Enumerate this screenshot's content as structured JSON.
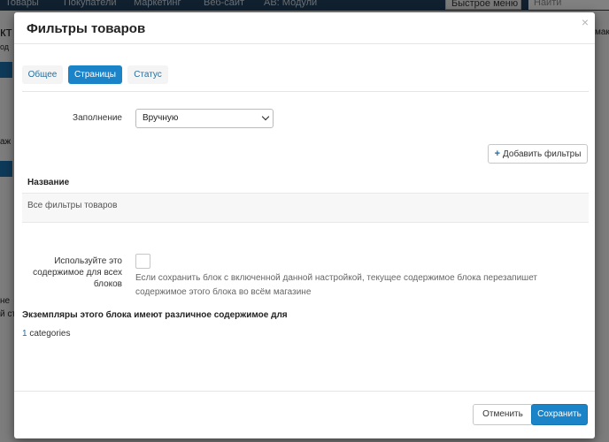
{
  "background": {
    "nav": [
      "Товары",
      "Покупатели",
      "Маркетинг",
      "Веб-сайт",
      "AB: Модули"
    ],
    "quick_menu": "Быстрое меню",
    "search_placeholder": "Найти",
    "left_fragments": [
      "кт",
      "од",
      "аж",
      "не",
      "й ст"
    ],
    "right_fragment": "мак"
  },
  "modal": {
    "title": "Фильтры товаров",
    "close_glyph": "×",
    "tabs": [
      {
        "label": "Общее",
        "active": false
      },
      {
        "label": "Страницы",
        "active": true
      },
      {
        "label": "Статус",
        "active": false
      }
    ],
    "fill": {
      "label": "Заполнение",
      "selected": "Вручную"
    },
    "add_filters_label": "Добавить фильтры",
    "table": {
      "header": "Название",
      "rows": [
        "Все фильтры товаров"
      ]
    },
    "use_for_all": {
      "label_lines": [
        "Используйте это",
        "содержимое для всех",
        "блоков"
      ],
      "checked": false,
      "help": "Если сохранить блок с включенной данной настройкой, текущее содержимое блока перезапишет содержимое этого блока во всём магазине"
    },
    "instances": {
      "title": "Экземпляры этого блока имеют различное содержимое для",
      "count": "1",
      "entity": "categories"
    },
    "footer": {
      "cancel_label": "Отменить",
      "save_label": "Сохранить"
    }
  },
  "colors": {
    "primary": "#1b84c8",
    "topnav": "#1f3e5a"
  }
}
